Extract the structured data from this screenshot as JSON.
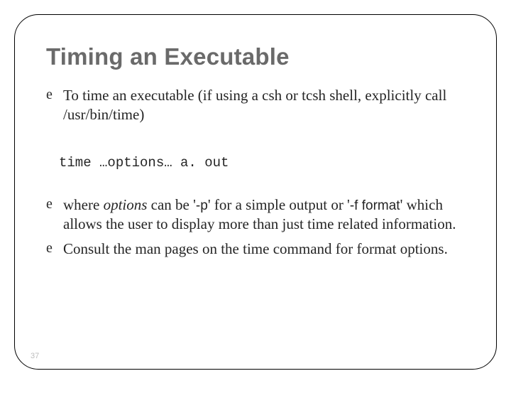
{
  "title": "Timing an Executable",
  "bullets": {
    "b1": "To time an executable (if using a csh or tcsh shell, explicitly call /usr/bin/time)",
    "code": "time …options… a. out",
    "b2_pre": "where ",
    "b2_em": "options",
    "b2_mid1": " can be '",
    "b2_code1": "-p",
    "b2_mid2": "' for a simple output or '",
    "b2_code2": "-f format",
    "b2_post": "' which allows the user to display more than just time related information.",
    "b3": "Consult the man pages on the time command for format options."
  },
  "glyph": "e",
  "pagenum": "37"
}
